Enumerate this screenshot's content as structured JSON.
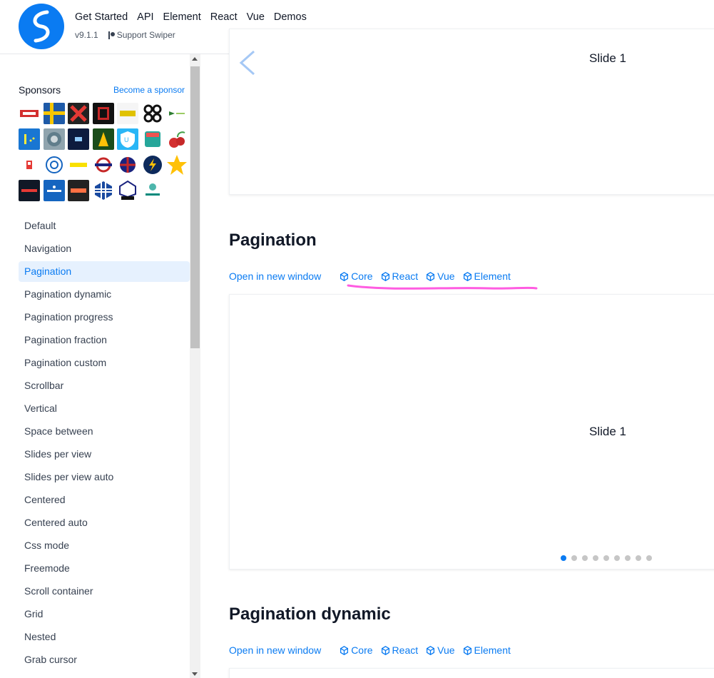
{
  "header": {
    "nav": [
      "Get Started",
      "API",
      "Element",
      "React",
      "Vue",
      "Demos"
    ],
    "version": "v9.1.1",
    "support": "Support Swiper",
    "brand_color": "#0a7bf2"
  },
  "sidebar": {
    "sponsors_title": "Sponsors",
    "become_sponsor": "Become a sponsor",
    "menu": [
      "Default",
      "Navigation",
      "Pagination",
      "Pagination dynamic",
      "Pagination progress",
      "Pagination fraction",
      "Pagination custom",
      "Scrollbar",
      "Vertical",
      "Space between",
      "Slides per view",
      "Slides per view auto",
      "Centered",
      "Centered auto",
      "Css mode",
      "Freemode",
      "Scroll container",
      "Grid",
      "Nested",
      "Grab cursor"
    ],
    "active_item": "Pagination"
  },
  "main": {
    "top_demo": {
      "slide_label": "Slide 1"
    },
    "pagination": {
      "title": "Pagination",
      "open_link": "Open in new window",
      "frameworks": [
        "Core",
        "React",
        "Vue",
        "Element"
      ],
      "slide_label": "Slide 1",
      "dot_count": 9,
      "active_dot": 0
    },
    "pagination_dynamic": {
      "title": "Pagination dynamic",
      "open_link": "Open in new window",
      "frameworks": [
        "Core",
        "React",
        "Vue",
        "Element"
      ]
    }
  },
  "annotation": {
    "color": "#ff5ce1"
  }
}
